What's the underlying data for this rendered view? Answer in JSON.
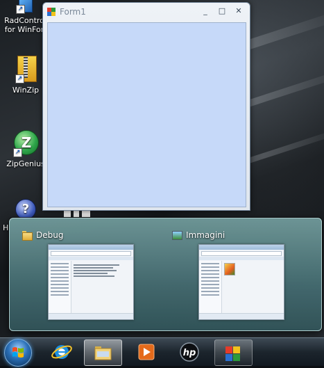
{
  "desktop": {
    "icons": [
      {
        "label": "RadControls for WinForms",
        "line1": "RadContro",
        "line2": "for WinFor",
        "icon": "radcontrols-icon"
      },
      {
        "label": "WinZip",
        "icon": "winzip-icon"
      },
      {
        "label": "ZipGenius",
        "icon": "zipgenius-icon"
      },
      {
        "label": "H",
        "icon": "help-icon"
      }
    ]
  },
  "form_window": {
    "title": "Form1",
    "minimize_glyph": "_",
    "maximize_glyph": "□",
    "close_glyph": "✕"
  },
  "flyout": {
    "thumbnails": [
      {
        "title": "Debug",
        "icon": "folder-icon"
      },
      {
        "title": "Immagini",
        "icon": "pictures-icon"
      }
    ]
  },
  "taskbar": {
    "buttons": [
      {
        "name": "start",
        "icon": "windows-start-icon"
      },
      {
        "name": "internet-explorer",
        "icon": "internet-explorer-icon"
      },
      {
        "name": "windows-explorer",
        "icon": "folder-icon",
        "state": "active"
      },
      {
        "name": "media-player",
        "icon": "media-player-icon"
      },
      {
        "name": "hp",
        "icon": "hp-icon"
      },
      {
        "name": "form-app",
        "icon": "app-window-icon",
        "state": "running"
      }
    ]
  },
  "colors": {
    "form_client": "#c6d9f9",
    "flyout": "#4f8688",
    "taskbar": "#1c252d"
  }
}
